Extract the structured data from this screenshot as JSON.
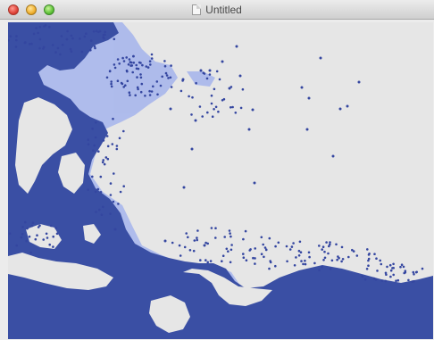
{
  "window": {
    "title": "Untitled",
    "title_icon": "document-icon",
    "controls": [
      "close-button",
      "minimize-button",
      "zoom-button"
    ]
  },
  "canvas": {
    "background_color": "#e6e6e6",
    "fill_color": "#3a4fa4",
    "halo_color": "#a9b7ec",
    "dot_color": "#3446a0"
  }
}
